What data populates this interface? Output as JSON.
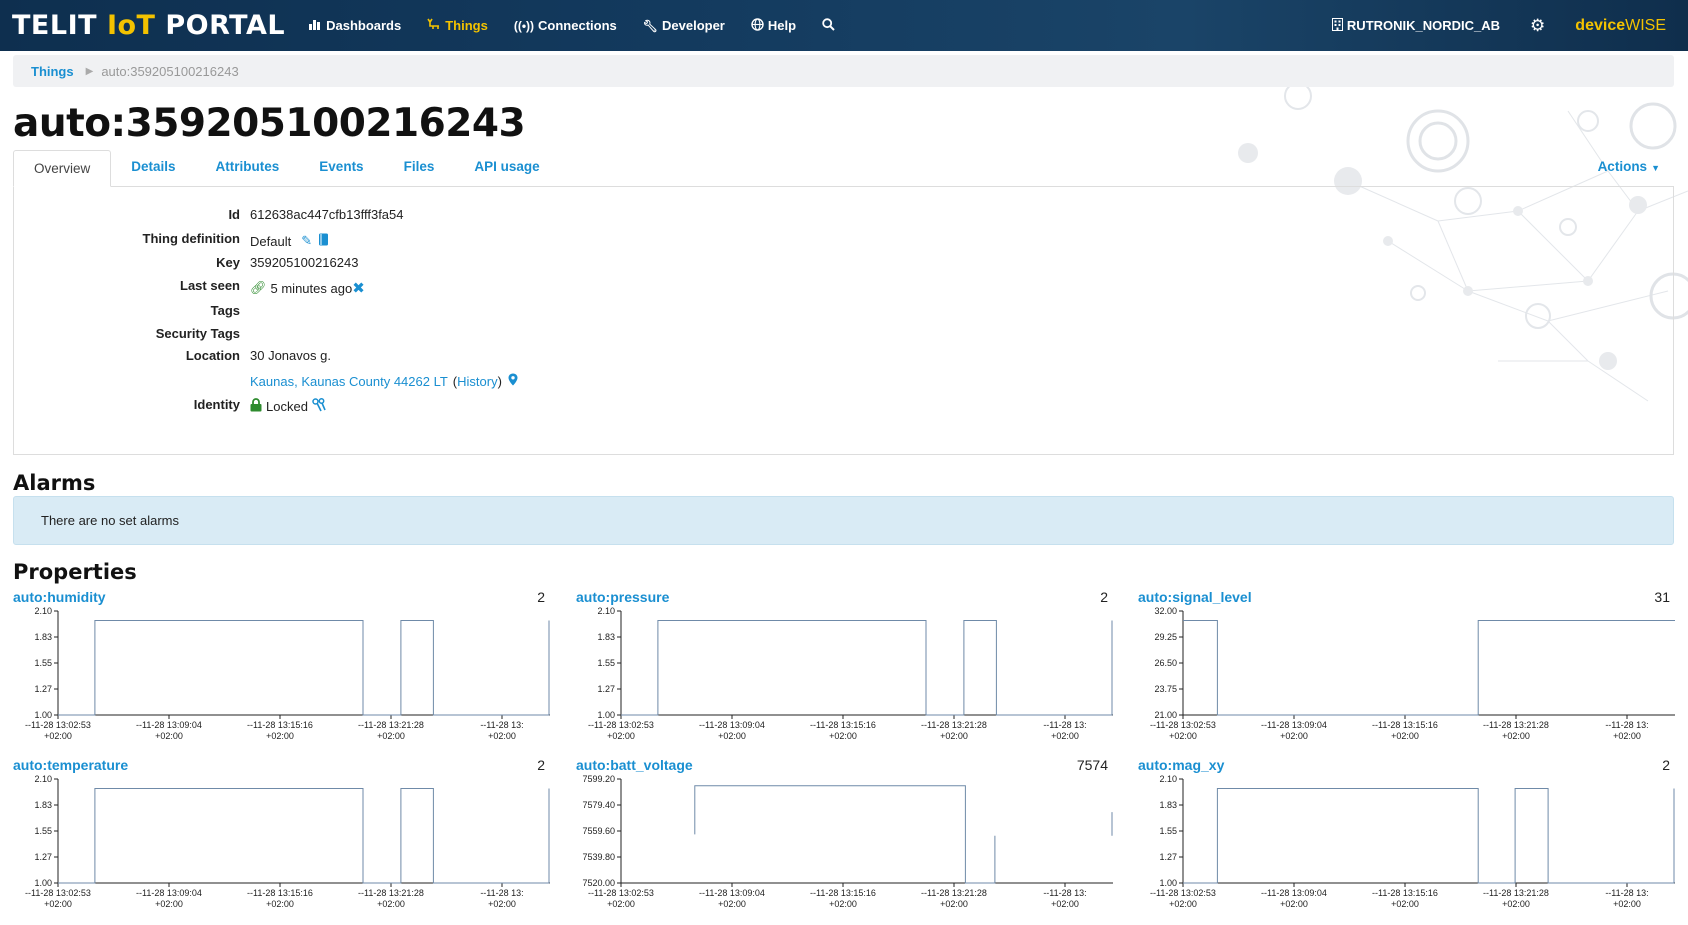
{
  "header": {
    "logo_prefix": "TELIT ",
    "logo_iot": "IoT",
    "logo_suffix": " PORTAL",
    "nav": [
      {
        "label": "Dashboards",
        "icon": "bar-chart-icon"
      },
      {
        "label": "Things",
        "icon": "things-icon",
        "active": true
      },
      {
        "label": "Connections",
        "icon": "signal-icon"
      },
      {
        "label": "Developer",
        "icon": "wrench-icon"
      },
      {
        "label": "Help",
        "icon": "globe-icon"
      }
    ],
    "organization": "RUTRONIK_NORDIC_AB",
    "brand_device": "device",
    "brand_wise": "WISE",
    "colors": {
      "nav_bg": "#133a5e",
      "accent": "#f3c200",
      "link": "#1a8fd1"
    }
  },
  "breadcrumb": {
    "root": "Things",
    "current": "auto:359205100216243"
  },
  "page_title": "auto:359205100216243",
  "tabs": [
    "Overview",
    "Details",
    "Attributes",
    "Events",
    "Files",
    "API usage"
  ],
  "actions_label": "Actions",
  "overview": {
    "id_label": "Id",
    "id_value": "612638ac447cfb13fff3fa54",
    "thingdef_label": "Thing definition",
    "thingdef_value": "Default",
    "key_label": "Key",
    "key_value": "359205100216243",
    "lastseen_label": "Last seen",
    "lastseen_value": "5 minutes ago",
    "tags_label": "Tags",
    "sectags_label": "Security Tags",
    "location_label": "Location",
    "location_line1": "30 Jonavos g.",
    "location_line2": "Kaunas, Kaunas County 44262 LT",
    "location_open": "(",
    "location_history": "History",
    "location_close": ")",
    "identity_label": "Identity",
    "identity_value": "Locked"
  },
  "alarms": {
    "title": "Alarms",
    "message": "There are no set alarms"
  },
  "properties_title": "Properties",
  "chart_data": [
    {
      "type": "line",
      "name": "auto:humidity",
      "current": "2",
      "yticks": [
        "2.10",
        "1.83",
        "1.55",
        "1.27",
        "1.00"
      ],
      "ylim": [
        1.0,
        2.1
      ],
      "xticks": [
        "--11-28 13:02:53",
        "--11-28 13:09:04",
        "--11-28 13:15:16",
        "--11-28 13:21:28",
        "--11-28 13:"
      ],
      "xsub": "+02:00",
      "series": [
        {
          "values": [
            [
              0.0,
              1.0
            ],
            [
              0.075,
              1.0
            ],
            [
              0.075,
              2.0
            ],
            [
              0.62,
              2.0
            ],
            [
              0.62,
              1.0
            ],
            [
              0.697,
              1.0
            ],
            [
              0.697,
              2.0
            ],
            [
              0.763,
              2.0
            ],
            [
              0.763,
              1.0
            ],
            [
              0.998,
              1.0
            ],
            [
              0.998,
              2.0
            ]
          ]
        }
      ]
    },
    {
      "type": "line",
      "name": "auto:pressure",
      "current": "2",
      "yticks": [
        "2.10",
        "1.83",
        "1.55",
        "1.27",
        "1.00"
      ],
      "ylim": [
        1.0,
        2.1
      ],
      "xticks": [
        "--11-28 13:02:53",
        "--11-28 13:09:04",
        "--11-28 13:15:16",
        "--11-28 13:21:28",
        "--11-28 13:"
      ],
      "xsub": "+02:00",
      "series": [
        {
          "values": [
            [
              0.0,
              1.0
            ],
            [
              0.075,
              1.0
            ],
            [
              0.075,
              2.0
            ],
            [
              0.62,
              2.0
            ],
            [
              0.62,
              1.0
            ],
            [
              0.697,
              1.0
            ],
            [
              0.697,
              2.0
            ],
            [
              0.763,
              2.0
            ],
            [
              0.763,
              1.0
            ],
            [
              0.998,
              1.0
            ],
            [
              0.998,
              2.0
            ]
          ]
        }
      ]
    },
    {
      "type": "line",
      "name": "auto:signal_level",
      "current": "31",
      "yticks": [
        "32.00",
        "29.25",
        "26.50",
        "23.75",
        "21.00"
      ],
      "ylim": [
        21.0,
        32.0
      ],
      "xticks": [
        "--11-28 13:02:53",
        "--11-28 13:09:04",
        "--11-28 13:15:16",
        "--11-28 13:21:28",
        "--11-28 13:"
      ],
      "xsub": "+02:00",
      "series": [
        {
          "values": [
            [
              0.0,
              31.0
            ],
            [
              0.07,
              31.0
            ],
            [
              0.07,
              21.0
            ],
            [
              0.6,
              21.0
            ],
            [
              0.6,
              31.0
            ],
            [
              1.0,
              31.0
            ]
          ]
        }
      ]
    },
    {
      "type": "line",
      "name": "auto:temperature",
      "current": "2",
      "yticks": [
        "2.10",
        "1.83",
        "1.55",
        "1.27",
        "1.00"
      ],
      "ylim": [
        1.0,
        2.1
      ],
      "xticks": [
        "--11-28 13:02:53",
        "--11-28 13:09:04",
        "--11-28 13:15:16",
        "--11-28 13:21:28",
        "--11-28 13:"
      ],
      "xsub": "+02:00",
      "series": [
        {
          "values": [
            [
              0.0,
              1.0
            ],
            [
              0.075,
              1.0
            ],
            [
              0.075,
              2.0
            ],
            [
              0.62,
              2.0
            ],
            [
              0.62,
              1.0
            ],
            [
              0.697,
              1.0
            ],
            [
              0.697,
              2.0
            ],
            [
              0.763,
              2.0
            ],
            [
              0.763,
              1.0
            ],
            [
              0.998,
              1.0
            ],
            [
              0.998,
              2.0
            ]
          ]
        }
      ]
    },
    {
      "type": "line",
      "name": "auto:batt_voltage",
      "current": "7574",
      "yticks": [
        "7599.20",
        "7579.40",
        "7559.60",
        "7539.80",
        "7520.00"
      ],
      "ylim": [
        7520.0,
        7599.2
      ],
      "xticks": [
        "--11-28 13:02:53",
        "--11-28 13:09:04",
        "--11-28 13:15:16",
        "--11-28 13:21:28",
        "--11-28 13:"
      ],
      "xsub": "+02:00",
      "series": [
        {
          "values": [
            [
              0.15,
              7557.0
            ],
            [
              0.15,
              7594.0
            ],
            [
              0.7,
              7594.0
            ],
            [
              0.7,
              7520.0
            ],
            [
              0.76,
              7520.0
            ],
            [
              0.76,
              7556.0
            ]
          ]
        },
        {
          "values": [
            [
              0.998,
              7556.0
            ],
            [
              0.998,
              7574.0
            ]
          ]
        }
      ]
    },
    {
      "type": "line",
      "name": "auto:mag_xy",
      "current": "2",
      "yticks": [
        "2.10",
        "1.83",
        "1.55",
        "1.27",
        "1.00"
      ],
      "ylim": [
        1.0,
        2.1
      ],
      "xticks": [
        "--11-28 13:02:53",
        "--11-28 13:09:04",
        "--11-28 13:15:16",
        "--11-28 13:21:28",
        "--11-28 13:"
      ],
      "xsub": "+02:00",
      "series": [
        {
          "values": [
            [
              0.0,
              1.0
            ],
            [
              0.07,
              1.0
            ],
            [
              0.07,
              2.0
            ],
            [
              0.6,
              2.0
            ],
            [
              0.6,
              1.0
            ],
            [
              0.675,
              1.0
            ],
            [
              0.675,
              2.0
            ],
            [
              0.742,
              2.0
            ],
            [
              0.742,
              1.0
            ],
            [
              0.998,
              1.0
            ],
            [
              0.998,
              2.0
            ]
          ]
        }
      ]
    }
  ]
}
